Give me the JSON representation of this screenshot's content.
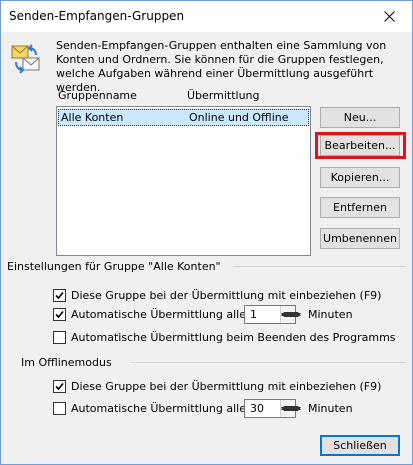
{
  "window": {
    "title": "Senden-Empfangen-Gruppen",
    "close_icon": "close-icon"
  },
  "intro": {
    "icon": "send-receive-groups-icon",
    "text": "Senden-Empfangen-Gruppen enthalten eine Sammlung von Konten und Ordnern. Sie können für die Gruppen festlegen, welche Aufgaben während einer Übermittlung ausgeführt werden."
  },
  "groups_list": {
    "columns": [
      "Gruppenname",
      "Übermittlung"
    ],
    "rows": [
      {
        "name": "Alle Konten",
        "mode": "Online und Offline",
        "selected": true
      }
    ]
  },
  "buttons": {
    "new": "Neu...",
    "edit": "Bearbeiten...",
    "copy": "Kopieren...",
    "remove": "Entfernen",
    "rename": "Umbenennen",
    "close": "Schließen"
  },
  "settings_group": {
    "label": "Einstellungen für Gruppe \"Alle Konten\"",
    "include_in_send_receive": {
      "label": "Diese Gruppe bei der Übermittlung mit einbeziehen (F9)",
      "checked": true
    },
    "auto_send_receive": {
      "label": "Automatische Übermittlung alle",
      "checked": true,
      "value": "1",
      "unit": "Minuten"
    },
    "send_receive_on_exit": {
      "label": "Automatische Übermittlung beim Beenden des Programms",
      "checked": false
    }
  },
  "offline_group": {
    "label": "Im Offlinemodus",
    "include_in_send_receive": {
      "label": "Diese Gruppe bei der Übermittlung mit einbeziehen (F9)",
      "checked": true
    },
    "auto_send_receive": {
      "label": "Automatische Übermittlung alle",
      "checked": false,
      "value": "30",
      "unit": "Minuten"
    }
  },
  "colors": {
    "selection": "#cce8ff",
    "highlight": "#e0121a",
    "default_button_border": "#0078d7"
  }
}
